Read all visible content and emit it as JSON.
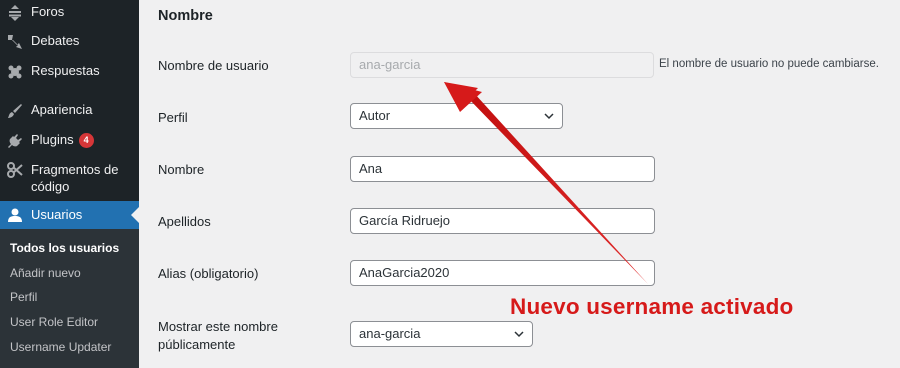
{
  "sidebar": {
    "items": [
      {
        "label": "Foros",
        "icon": "forum-icon"
      },
      {
        "label": "Debates",
        "icon": "topics-icon"
      },
      {
        "label": "Respuestas",
        "icon": "replies-icon"
      },
      {
        "label": "Apariencia",
        "icon": "paintbrush-icon"
      },
      {
        "label": "Plugins",
        "icon": "plugin-icon",
        "badge": "4"
      },
      {
        "label": "Fragmentos de",
        "label2": "código",
        "icon": "scissors-icon"
      },
      {
        "label": "Usuarios",
        "icon": "user-icon",
        "active": true
      }
    ],
    "submenu": [
      {
        "label": "Todos los usuarios",
        "current": true
      },
      {
        "label": "Añadir nuevo"
      },
      {
        "label": "Perfil"
      },
      {
        "label": "User Role Editor"
      },
      {
        "label": "Username Updater"
      }
    ]
  },
  "form": {
    "section_title": "Nombre",
    "username": {
      "label": "Nombre de usuario",
      "value": "ana-garcia",
      "hint": "El nombre de usuario no puede cambiarse."
    },
    "role": {
      "label": "Perfil",
      "value": "Autor"
    },
    "first_name": {
      "label": "Nombre",
      "value": "Ana"
    },
    "last_name": {
      "label": "Apellidos",
      "value": "García Ridruejo"
    },
    "nickname": {
      "label": "Alias (obligatorio)",
      "value": "AnaGarcia2020"
    },
    "display_name": {
      "label": "Mostrar este nombre",
      "label2": "públicamente",
      "value": "ana-garcia"
    }
  },
  "annotation": {
    "text": "Nuevo username activado",
    "color": "#d61a1a"
  },
  "colors": {
    "sidebar_bg": "#1d2327",
    "accent": "#2271b1",
    "badge": "#d63638"
  }
}
